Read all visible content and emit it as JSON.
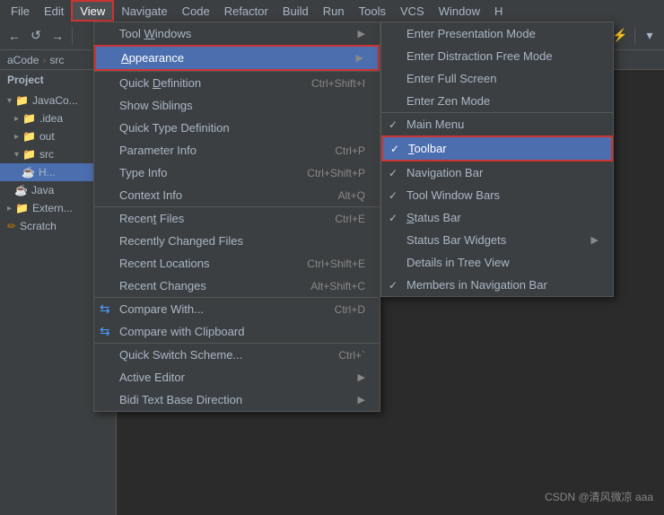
{
  "menubar": {
    "items": [
      "File",
      "Edit",
      "View",
      "Navigate",
      "Code",
      "Refactor",
      "Build",
      "Run",
      "Tools",
      "VCS",
      "Window",
      "H"
    ]
  },
  "breadcrumb": {
    "parts": [
      "aCode",
      "src"
    ]
  },
  "sidebar": {
    "header": "Project",
    "items": [
      {
        "label": "JavaCo...",
        "level": 0,
        "type": "project",
        "icon": "▾"
      },
      {
        "label": ".idea",
        "level": 1,
        "type": "folder"
      },
      {
        "label": "out",
        "level": 1,
        "type": "folder"
      },
      {
        "label": "src",
        "level": 1,
        "type": "folder"
      },
      {
        "label": "H...",
        "level": 2,
        "type": "java"
      },
      {
        "label": "Java",
        "level": 1,
        "type": "java"
      },
      {
        "label": "Extern...",
        "level": 0,
        "type": "folder"
      },
      {
        "label": "Scratch",
        "level": 0,
        "type": "scratch"
      }
    ]
  },
  "view_menu": {
    "items": [
      {
        "label": "Tool Windows",
        "shortcut": "",
        "arrow": true,
        "id": "tool-windows"
      },
      {
        "label": "Appearance",
        "shortcut": "",
        "arrow": true,
        "highlighted": true,
        "id": "appearance"
      },
      {
        "label": "Quick Definition",
        "shortcut": "Ctrl+Shift+I",
        "id": "quick-def"
      },
      {
        "label": "Show Siblings",
        "shortcut": "",
        "id": "show-siblings"
      },
      {
        "label": "Quick Type Definition",
        "shortcut": "",
        "id": "quick-type-def"
      },
      {
        "label": "Parameter Info",
        "shortcut": "Ctrl+P",
        "id": "param-info"
      },
      {
        "label": "Type Info",
        "shortcut": "Ctrl+Shift+P",
        "id": "type-info"
      },
      {
        "label": "Context Info",
        "shortcut": "Alt+Q",
        "id": "context-info"
      },
      {
        "label": "Recent Files",
        "shortcut": "Ctrl+E",
        "id": "recent-files"
      },
      {
        "label": "Recently Changed Files",
        "shortcut": "",
        "id": "recently-changed"
      },
      {
        "label": "Recent Locations",
        "shortcut": "Ctrl+Shift+E",
        "id": "recent-locations"
      },
      {
        "label": "Recent Changes",
        "shortcut": "Alt+Shift+C",
        "id": "recent-changes"
      },
      {
        "label": "Compare With...",
        "shortcut": "Ctrl+D",
        "hasIcon": true,
        "id": "compare-with"
      },
      {
        "label": "Compare with Clipboard",
        "shortcut": "",
        "hasIcon": true,
        "id": "compare-clipboard"
      },
      {
        "label": "Quick Switch Scheme...",
        "shortcut": "Ctrl+`",
        "id": "quick-switch"
      },
      {
        "label": "Active Editor",
        "shortcut": "",
        "arrow": true,
        "id": "active-editor"
      },
      {
        "label": "Bidi Text Base Direction",
        "shortcut": "",
        "arrow": true,
        "id": "bidi"
      }
    ]
  },
  "appearance_menu": {
    "items": [
      {
        "label": "Enter Presentation Mode",
        "id": "presentation-mode"
      },
      {
        "label": "Enter Distraction Free Mode",
        "id": "distraction-mode"
      },
      {
        "label": "Enter Full Screen",
        "id": "full-screen"
      },
      {
        "label": "Enter Zen Mode",
        "id": "zen-mode"
      },
      {
        "label": "Main Menu",
        "check": true,
        "id": "main-menu"
      },
      {
        "label": "Toolbar",
        "check": true,
        "highlighted": true,
        "id": "toolbar"
      },
      {
        "label": "Navigation Bar",
        "check": true,
        "id": "nav-bar"
      },
      {
        "label": "Tool Window Bars",
        "check": true,
        "id": "tool-window-bars"
      },
      {
        "label": "Status Bar",
        "check": true,
        "id": "status-bar"
      },
      {
        "label": "Status Bar Widgets",
        "arrow": true,
        "id": "status-bar-widgets"
      },
      {
        "label": "Details in Tree View",
        "id": "details-tree"
      },
      {
        "label": "Members in Navigation Bar",
        "check": true,
        "id": "members-nav"
      }
    ]
  },
  "watermark": "CSDN @清风微凉 aaa"
}
